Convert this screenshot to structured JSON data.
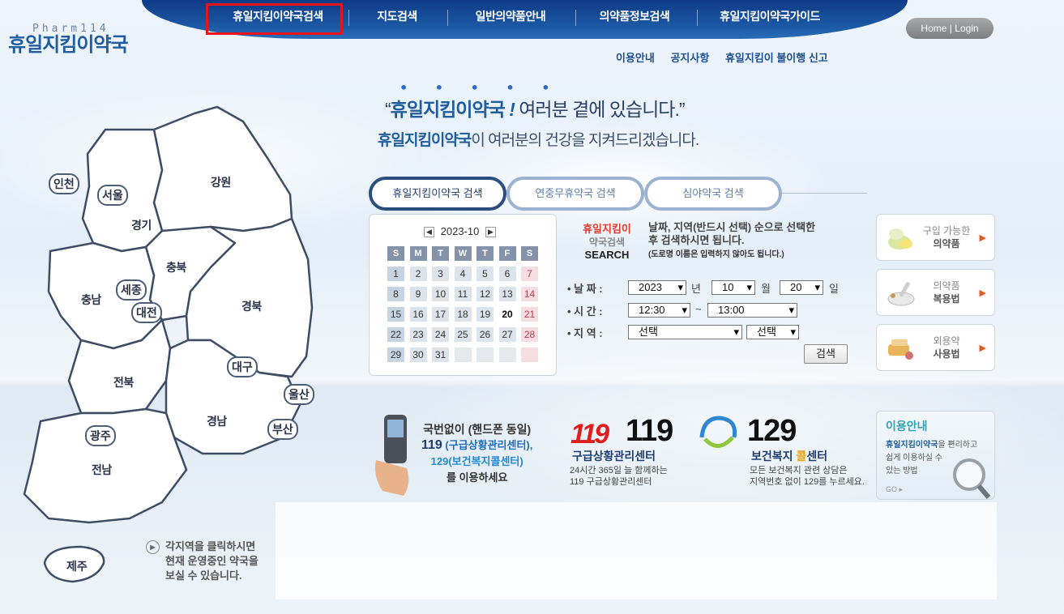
{
  "logo": {
    "top": "Pharm114",
    "main": "휴일지킴이약국"
  },
  "topnav": {
    "items": [
      "휴일지킴이약국검색",
      "지도검색",
      "일반의약품안내",
      "의약품정보검색",
      "휴일지킴이약국가이드"
    ]
  },
  "homelogin": "Home | Login",
  "subnav": [
    "이용안내",
    "공지사항",
    "휴일지킴이 불이행 신고"
  ],
  "headline": {
    "dots": "• • • • •",
    "line1_quote_open": "“",
    "line1_brand": "휴일지킴이약국",
    "line1_bang": "!",
    "line1_rest": " 여러분 곁에 있습니다.”",
    "line2_brand": "휴일지킴이약국",
    "line2_rest": "이 여러분의 건강을 지켜드리겠습니다."
  },
  "tabs": [
    "휴일지킴이약국 검색",
    "연중무휴약국 검색",
    "심야약국 검색"
  ],
  "calendar": {
    "prev": "◀",
    "next": "▶",
    "month": "2023-10",
    "dow": [
      "S",
      "M",
      "T",
      "W",
      "T",
      "F",
      "S"
    ],
    "weeks": [
      [
        "1",
        "2",
        "3",
        "4",
        "5",
        "6",
        "7"
      ],
      [
        "8",
        "9",
        "10",
        "11",
        "12",
        "13",
        "14"
      ],
      [
        "15",
        "16",
        "17",
        "18",
        "19",
        "20",
        "21"
      ],
      [
        "22",
        "23",
        "24",
        "25",
        "26",
        "27",
        "28"
      ],
      [
        "29",
        "30",
        "31",
        "",
        "",
        "",
        ""
      ]
    ],
    "today": "20"
  },
  "search": {
    "brand1": "휴일지킴이",
    "brand2": "약국검색",
    "brand3": "SEARCH",
    "instr1": "날짜, 지역(반드시 선택) 순으로 선택한",
    "instr2": "후 검색하시면 됩니다.",
    "instr3": "(도로명 이름은 입력하지 않아도 됩니다.)",
    "date_label": "• 날 짜 :",
    "year": "2023",
    "year_unit": "년",
    "month": "10",
    "month_unit": "월",
    "day": "20",
    "day_unit": "일",
    "time_label": "• 시 간 :",
    "time_from": "12:30",
    "time_sep": "~",
    "time_to": "13:00",
    "region_label": "• 지 역 :",
    "region1": "선택",
    "region2": "선택",
    "button": "검색"
  },
  "side_cards": [
    {
      "label1": "구입 가능한",
      "label2": "의약품"
    },
    {
      "label1": "의약품",
      "label2": "복용법"
    },
    {
      "label1": "외용약",
      "label2": "사용법"
    }
  ],
  "side_arrow": "▶",
  "phone": {
    "l1": "국번없이 (핸드폰 동일)",
    "l2a": "119",
    "l2b": " (구급상황관리센터),",
    "l3": "129(보건복지콜센터)",
    "l4": "를 이용하세요"
  },
  "n119": {
    "logo": "119",
    "number": "119",
    "title": "구급상황관리센터",
    "desc1": "24시간 365일 늘 함께하는",
    "desc2": "119 구급상황관리센터"
  },
  "n129": {
    "number": "129",
    "title_a": "보건복지 ",
    "title_b": "콜",
    "title_c": "센터",
    "desc1": "모든 보건복지 관련 상담은",
    "desc2": "지역번호 없이 129를 누르세요."
  },
  "info_card": {
    "title": "이용안내",
    "d_brand": "휴일지킴이약국",
    "d_rest1": "을 편리하고",
    "d_rest2": "쉽게 이용하실 수",
    "d_rest3": "있는 방법",
    "go": "GO ▸"
  },
  "map": {
    "regions": [
      "강원",
      "경기",
      "충북",
      "충남",
      "경북",
      "전북",
      "경남",
      "전남"
    ],
    "cities": [
      "인천",
      "서울",
      "세종",
      "대전",
      "대구",
      "울산",
      "부산",
      "광주",
      "제주"
    ]
  },
  "map_hint": {
    "icon": "▶",
    "l1": "각지역을 클릭하시면",
    "l2": "현재 운영중인 약국을",
    "l3": "보실 수 있습니다."
  },
  "colors": {
    "nav": "#1c5aa6",
    "brand": "#1f5da0",
    "highlight": "#e8141a",
    "red": "#e01d1d"
  }
}
